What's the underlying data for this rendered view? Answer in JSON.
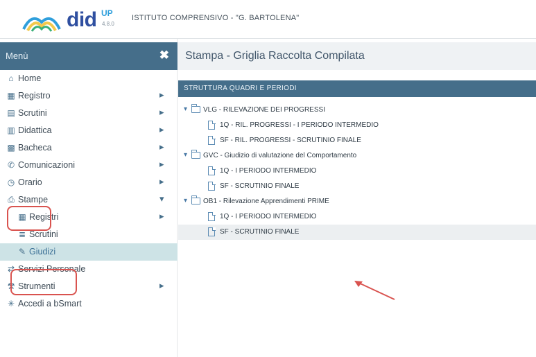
{
  "header": {
    "logo_main": "did",
    "logo_sup": "UP",
    "logo_version": "4.8.0",
    "school": "ISTITUTO COMPRENSIVO - \"G. BARTOLENA\""
  },
  "sidebar": {
    "title": "Menù",
    "close_icon": "close-icon",
    "items": [
      {
        "label": "Home",
        "icon": "home-icon",
        "has_arrow": false
      },
      {
        "label": "Registro",
        "icon": "calendar-icon",
        "has_arrow": true
      },
      {
        "label": "Scrutini",
        "icon": "document-icon",
        "has_arrow": true
      },
      {
        "label": "Didattica",
        "icon": "book-icon",
        "has_arrow": true
      },
      {
        "label": "Bacheca",
        "icon": "grid-icon",
        "has_arrow": true
      },
      {
        "label": "Comunicazioni",
        "icon": "megaphone-icon",
        "has_arrow": true
      },
      {
        "label": "Orario",
        "icon": "clock-icon",
        "has_arrow": true
      },
      {
        "label": "Stampe",
        "icon": "printer-icon",
        "has_arrow": true,
        "expanded": true
      },
      {
        "label": "Registri",
        "icon": "calendar-icon",
        "has_arrow": true,
        "sub": true
      },
      {
        "label": "Scrutini",
        "icon": "list-icon",
        "has_arrow": false,
        "sub": true
      },
      {
        "label": "Giudizi",
        "icon": "edit-icon",
        "has_arrow": false,
        "sub": true,
        "selected": true
      },
      {
        "label": "Servizi Personale",
        "icon": "share-icon",
        "has_arrow": false
      },
      {
        "label": "Strumenti",
        "icon": "wrench-icon",
        "has_arrow": true
      },
      {
        "label": "Accedi a bSmart",
        "icon": "asterisk-icon",
        "has_arrow": false
      }
    ]
  },
  "main": {
    "page_title": "Stampa - Griglia Raccolta Compilata",
    "section_title": "STRUTTURA QUADRI E PERIODI",
    "tree": [
      {
        "type": "folder",
        "label": "VLG - RILEVAZIONE DEI PROGRESSI"
      },
      {
        "type": "doc",
        "label": "1Q - RIL. PROGRESSI - I PERIODO INTERMEDIO"
      },
      {
        "type": "doc",
        "label": "SF - RIL. PROGRESSI - SCRUTINIO FINALE"
      },
      {
        "type": "folder",
        "label": "GVC - Giudizio di valutazione del Comportamento"
      },
      {
        "type": "doc",
        "label": "1Q - I PERIODO INTERMEDIO"
      },
      {
        "type": "doc",
        "label": "SF - SCRUTINIO FINALE"
      },
      {
        "type": "folder",
        "label": "OB1 - Rilevazione Apprendimenti PRIME"
      },
      {
        "type": "doc",
        "label": "1Q - I PERIODO INTERMEDIO"
      },
      {
        "type": "doc",
        "label": "SF - SCRUTINIO FINALE",
        "selected": true
      }
    ]
  },
  "colors": {
    "accent": "#456e8a",
    "highlight": "#d9534f",
    "selected_bg": "#cde3e6"
  }
}
